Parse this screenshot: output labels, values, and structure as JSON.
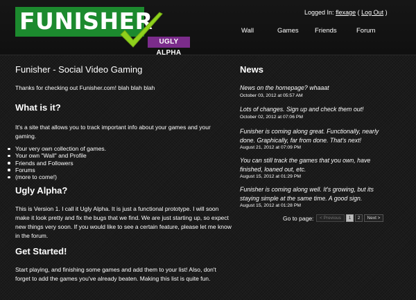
{
  "header": {
    "logo": {
      "brand": "FUNISHER",
      "tagline": "UGLY ALPHA"
    },
    "login": {
      "prefix": "Logged In:",
      "username": "flexage",
      "paren_open": "(",
      "logout": "Log Out",
      "paren_close": ")"
    },
    "nav": [
      {
        "label": "Wall"
      },
      {
        "label": "Games"
      },
      {
        "label": "Friends"
      },
      {
        "label": "Forum"
      }
    ]
  },
  "main": {
    "title": "Funisher - Social Video Gaming",
    "intro": "Thanks for checking out Funisher.com! blah blah blah",
    "what_heading": "What is it?",
    "what_text": "It's a site that allows you to track important info about your games and your gaming.",
    "features": [
      "Your very own collection of games.",
      "Your own \"Wall\" and Profile",
      "Friends and Followers",
      "Forums",
      "(more to come!)"
    ],
    "alpha_heading": "Ugly Alpha?",
    "alpha_text": "This is Version 1. I call it Ugly Alpha. It is just a functional prototype. I will soon make it look pretty and fix the bugs that we find. We are just starting up, so expect new things very soon. If you would like to see a certain feature, please let me know in the forum.",
    "started_heading": "Get Started!",
    "started_text": "Start playing, and finishing some games and add them to your list! Also, don't forget to add the games you've already beaten. Making this list is quite fun."
  },
  "news": {
    "title": "News",
    "items": [
      {
        "text": "News on the homepage? whaaat",
        "date": "October 03, 2012 at 05:57 AM"
      },
      {
        "text": "Lots of changes. Sign up and check them out!",
        "date": "October 02, 2012 at 07:06 PM"
      },
      {
        "text": "Funisher is coming along great. Functionally, nearly done. Graphically, far from done. That's next!",
        "date": "August 21, 2012 at 07:09 PM"
      },
      {
        "text": "You can still track the games that you own, have finished, loaned out, etc.",
        "date": "August 15, 2012 at 01:29 PM"
      },
      {
        "text": "Funisher is coming along well. It's growing, but its staying simple at the same time. A good sign.",
        "date": "August 15, 2012 at 01:28 PM"
      }
    ],
    "pager": {
      "label": "Go to page:",
      "prev": "< Previous",
      "pages": [
        "1",
        "2"
      ],
      "current": "1",
      "next": "Next >"
    }
  },
  "colors": {
    "logo_green": "#1c8a2e",
    "check_green": "#8fd11c",
    "alpha_purple": "#7b2c8b",
    "background": "#1b1b1b"
  }
}
